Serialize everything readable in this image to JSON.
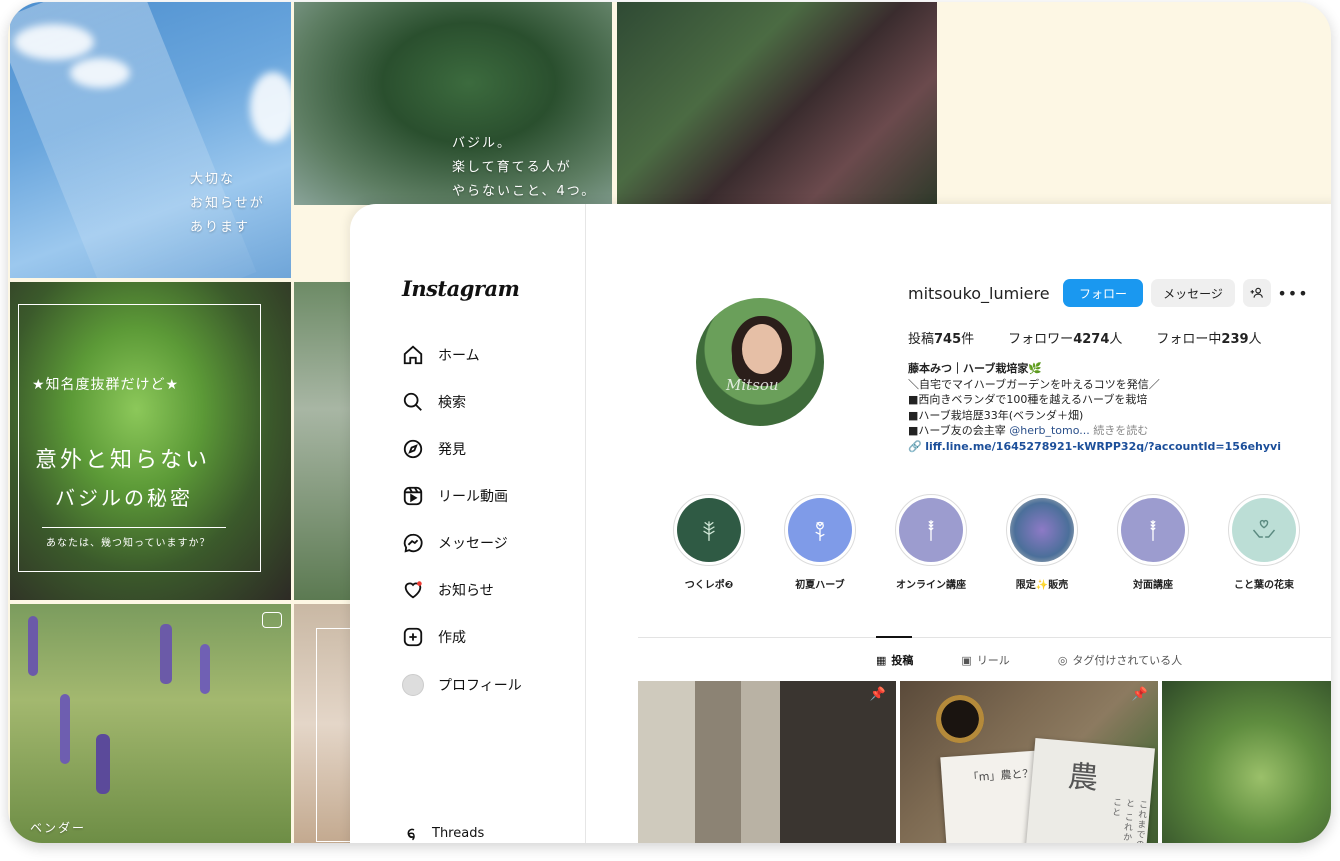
{
  "background_tiles": {
    "sky_text": "大切な\nお知らせが\nあります",
    "basil_text": "バジル。\n楽して育てる人が\nやらないこと、4つ。",
    "mint_banner": "★知名度抜群だけど★",
    "mint_title1": "意外と知らない",
    "mint_title2": "バジルの秘密",
    "mint_sub": "あなたは、幾つ知っていますか？",
    "lavender_caption": "ベンダー"
  },
  "sidebar": {
    "logo": "Instagram",
    "items": [
      {
        "label": "ホーム",
        "icon": "home-icon"
      },
      {
        "label": "検索",
        "icon": "search-icon"
      },
      {
        "label": "発見",
        "icon": "compass-icon"
      },
      {
        "label": "リール動画",
        "icon": "reels-icon"
      },
      {
        "label": "メッセージ",
        "icon": "messenger-icon"
      },
      {
        "label": "お知らせ",
        "icon": "heart-icon"
      },
      {
        "label": "作成",
        "icon": "plus-square-icon"
      },
      {
        "label": "プロフィール",
        "icon": "profile-avatar-icon"
      }
    ],
    "threads_label": "Threads"
  },
  "profile": {
    "username": "mitsouko_lumiere",
    "follow_label": "フォロー",
    "message_label": "メッセージ",
    "add_user_icon": "+ß",
    "more_icon": "•••",
    "avatar_signature": "Mitsou",
    "stats": {
      "posts_label": "投稿",
      "posts_value": "745",
      "posts_unit": "件",
      "followers_label": "フォロワー",
      "followers_value": "4274",
      "followers_unit": "人",
      "following_label": "フォロー中",
      "following_value": "239",
      "following_unit": "人"
    },
    "bio": {
      "name": "藤本みつ｜ハーブ栽培家🌿",
      "line1": "＼自宅でマイハーブガーデンを叶えるコツを発信／",
      "line2": "■西向きベランダで100種を越えるハーブを栽培",
      "line3": "■ハーブ栽培歴33年(ベランダ＋畑)",
      "line4_text": "■ハーブ友の会主宰 ",
      "line4_mention": "@herb_tomo...",
      "line4_more": " 続きを読む",
      "url": "liff.line.me/1645278921-kWRPP32q/?accountId=156ehyvi"
    }
  },
  "highlights": [
    {
      "label": "つくレポ❷",
      "color": "#2f5a44"
    },
    {
      "label": "初夏ハーブ",
      "color": "#7f9be8"
    },
    {
      "label": "オンライン講座",
      "color": "#9c9ccf"
    },
    {
      "label": "限定✨販売",
      "color": "#6a78b8"
    },
    {
      "label": "対面講座",
      "color": "#9c9ccf"
    },
    {
      "label": "こと葉の花束",
      "color": "#bcded6"
    }
  ],
  "tabs": [
    {
      "label": "投稿",
      "icon": "grid-icon",
      "active": true
    },
    {
      "label": "リール",
      "icon": "reels-icon",
      "active": false
    },
    {
      "label": "タグ付けされている人",
      "icon": "tag-icon",
      "active": false
    }
  ],
  "posts": {
    "p2_book1_title": "「m」農と？",
    "p2_book2_kanji": "農",
    "p2_book2_side": "これまでのこと これからのこと"
  },
  "colors": {
    "accent": "#1a98f0",
    "frame_bg": "#fdf7e4"
  }
}
